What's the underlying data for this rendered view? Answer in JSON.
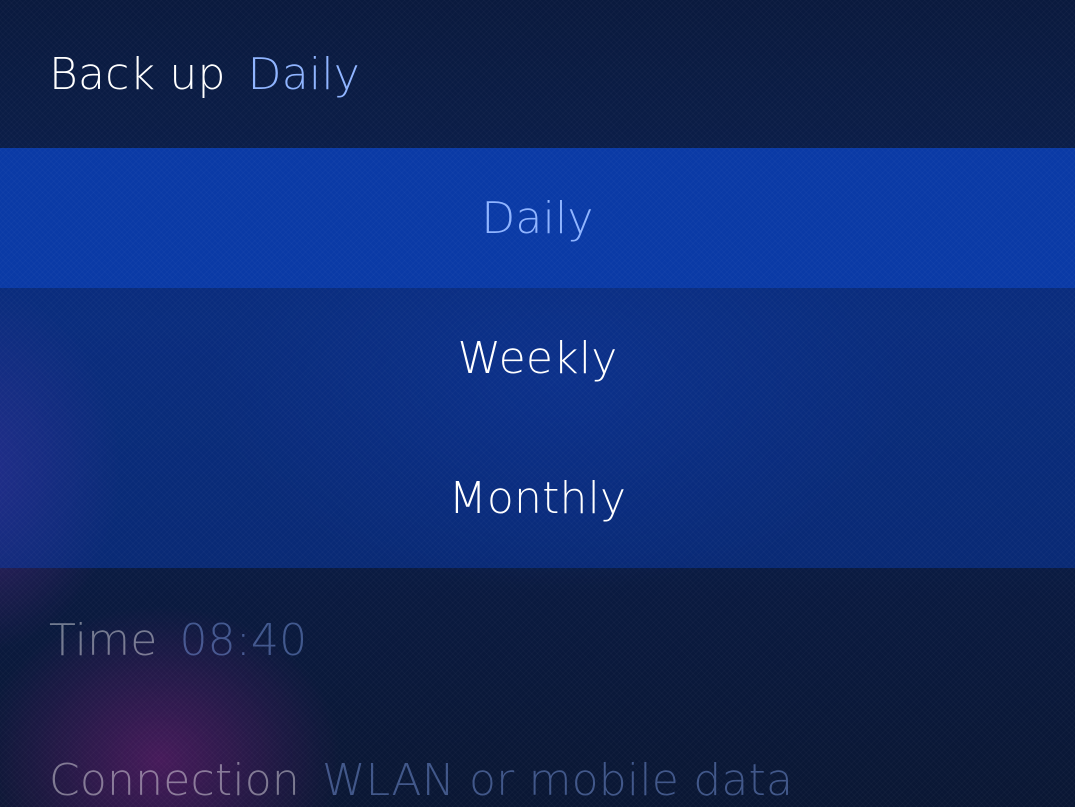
{
  "backup": {
    "label": "Back up",
    "value": "Daily"
  },
  "menu": {
    "items": [
      {
        "label": "Daily",
        "selected": true
      },
      {
        "label": "Weekly",
        "selected": false
      },
      {
        "label": "Monthly",
        "selected": false
      }
    ]
  },
  "time": {
    "label": "Time",
    "value": "08:40"
  },
  "connection": {
    "label": "Connection",
    "value": "WLAN or mobile data"
  },
  "colors": {
    "accent": "#8fb4ff",
    "highlight": "#0a3aa6",
    "menu_background": "#0c2f8a",
    "background": "#0c2254"
  }
}
